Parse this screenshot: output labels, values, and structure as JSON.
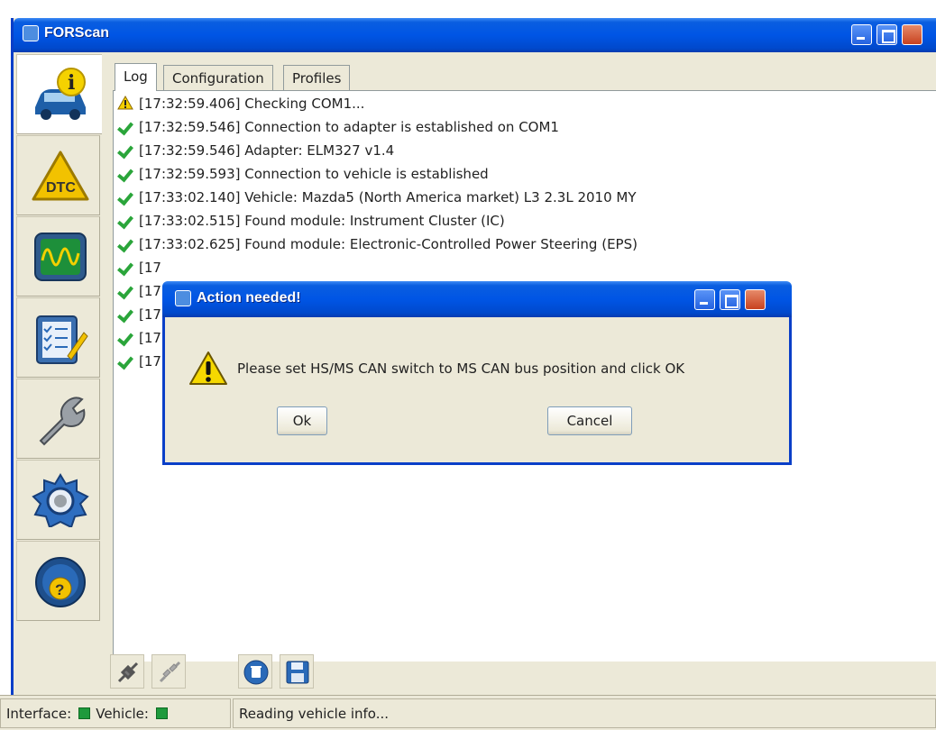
{
  "window": {
    "title": "FORScan"
  },
  "tabs": [
    "Log",
    "Configuration",
    "Profiles"
  ],
  "log": [
    {
      "status": "warning",
      "text": "[17:32:59.406] Checking COM1..."
    },
    {
      "status": "ok",
      "text": "[17:32:59.546] Connection to adapter is established on COM1"
    },
    {
      "status": "ok",
      "text": "[17:32:59.546] Adapter:  ELM327 v1.4"
    },
    {
      "status": "ok",
      "text": "[17:32:59.593] Connection to vehicle is established"
    },
    {
      "status": "ok",
      "text": "[17:33:02.140] Vehicle: Mazda5 (North America market) L3 2.3L 2010 MY"
    },
    {
      "status": "ok",
      "text": "[17:33:02.515] Found module:  Instrument Cluster (IC)"
    },
    {
      "status": "ok",
      "text": "[17:33:02.625] Found module:  Electronic-Controlled Power Steering (EPS)"
    },
    {
      "status": "ok",
      "text": "[17"
    },
    {
      "status": "ok",
      "text": "[17"
    },
    {
      "status": "ok",
      "text": "[17"
    },
    {
      "status": "ok",
      "text": "[17"
    },
    {
      "status": "ok",
      "text": "[17"
    }
  ],
  "sidebar": {
    "items": [
      {
        "name": "vehicle-info",
        "icon": "car-info-icon"
      },
      {
        "name": "dtc",
        "icon": "dtc-icon",
        "label": "DTC"
      },
      {
        "name": "oscilloscope",
        "icon": "oscilloscope-icon"
      },
      {
        "name": "tests",
        "icon": "checklist-icon"
      },
      {
        "name": "service",
        "icon": "wrench-icon"
      },
      {
        "name": "settings",
        "icon": "gear-icon"
      },
      {
        "name": "help",
        "icon": "help-steering-icon"
      }
    ]
  },
  "toolbar": {
    "buttons": [
      "connect-icon",
      "disconnect-icon",
      "clear-icon",
      "save-icon"
    ]
  },
  "status_bar": {
    "interface_label": "Interface:",
    "vehicle_label": "Vehicle:",
    "message": "Reading vehicle info...",
    "interface_color": "#1e9a3c",
    "vehicle_color": "#1e9a3c"
  },
  "dialog": {
    "title": "Action needed!",
    "message": "Please set HS/MS CAN switch to MS CAN bus position and click OK",
    "ok_label": "Ok",
    "cancel_label": "Cancel"
  }
}
